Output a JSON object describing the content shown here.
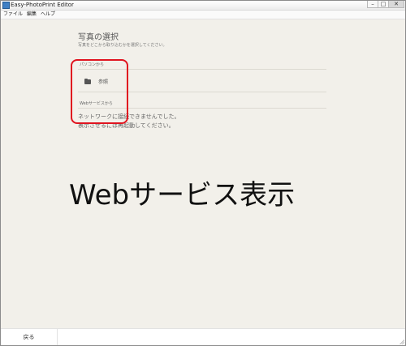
{
  "window": {
    "title": "Easy-PhotoPrint Editor",
    "controls": {
      "minimize": "–",
      "maximize": "□",
      "close": "✕"
    }
  },
  "menu": {
    "items": [
      "ファイル",
      "編集",
      "ヘルプ"
    ]
  },
  "page": {
    "title": "写真の選択",
    "subtitle": "写真をどこから取り込むかを選択してください。",
    "pc_section": {
      "label": "パソコンから",
      "browse_label": "参照",
      "icon": "folder-icon"
    },
    "web_section": {
      "label": "Webサービスから",
      "message_line1": "ネットワークに接続できませんでした。",
      "message_line2": "表示させるには再起動してください。"
    }
  },
  "overlay": {
    "text": "Webサービス表示",
    "highlight_color": "#e0141f"
  },
  "footer": {
    "back_label": "戻る"
  }
}
